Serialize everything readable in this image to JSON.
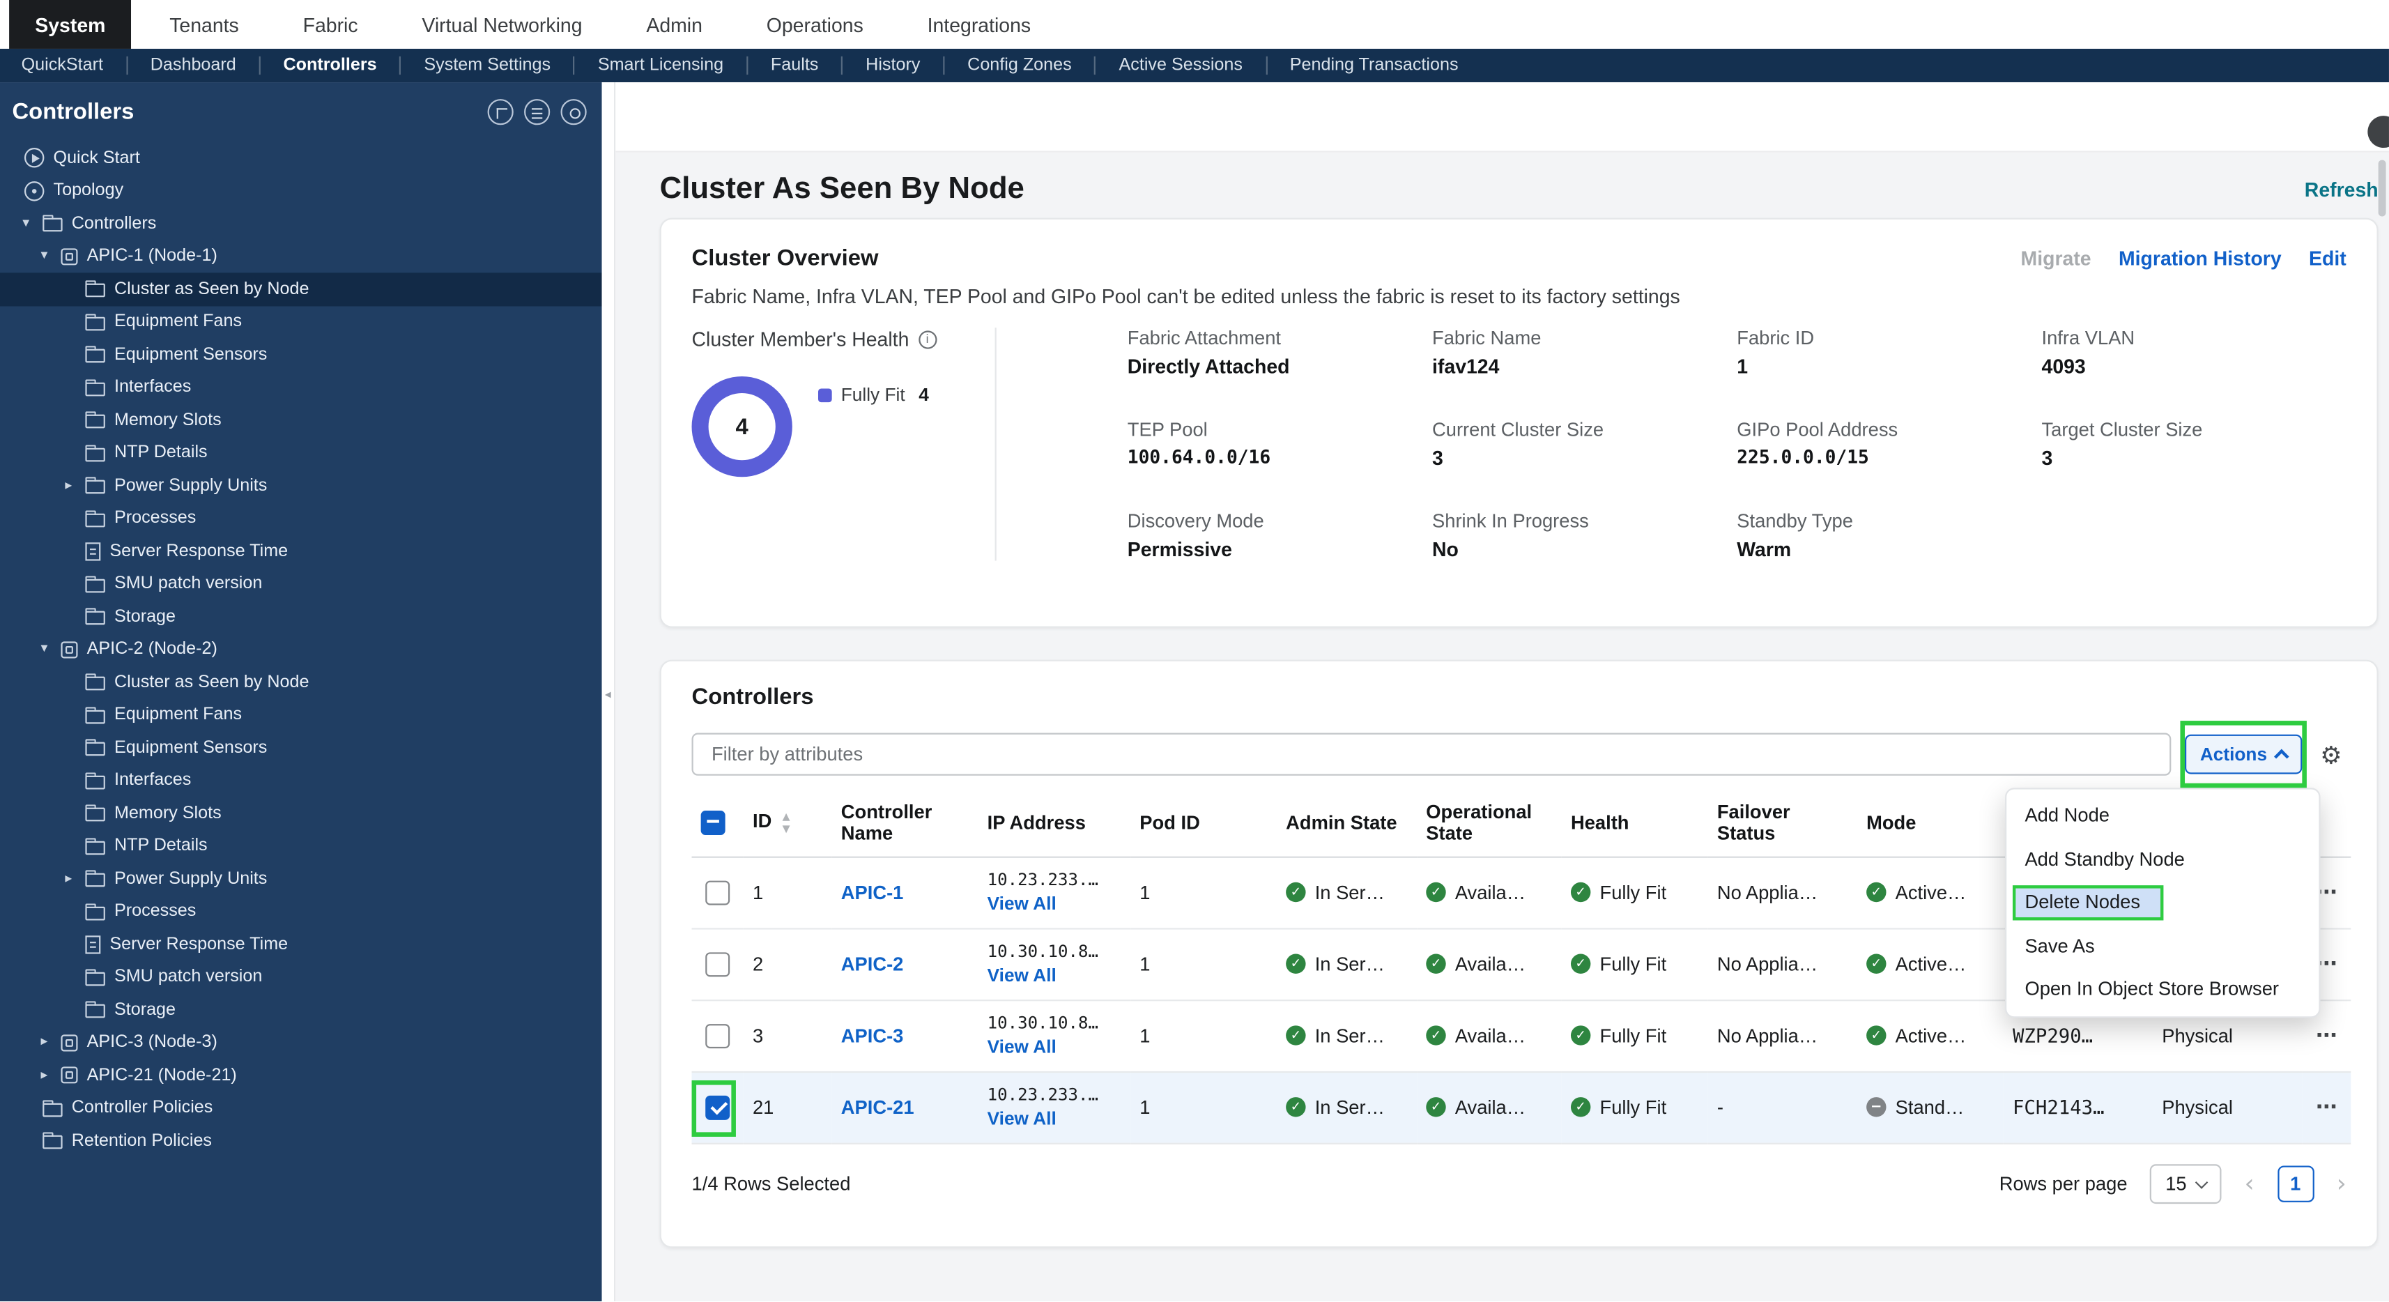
{
  "colors": {
    "accent_blue": "#1160c9",
    "status_green": "#2e8540",
    "donut_purple": "#5a5ed8",
    "annotation_green": "#2ecc40",
    "subnav_navy": "#143050",
    "sidebar_navy": "#203e63"
  },
  "top_nav": {
    "items": [
      "System",
      "Tenants",
      "Fabric",
      "Virtual Networking",
      "Admin",
      "Operations",
      "Integrations"
    ],
    "active": "System"
  },
  "sub_nav": {
    "items": [
      "QuickStart",
      "Dashboard",
      "Controllers",
      "System Settings",
      "Smart Licensing",
      "Faults",
      "History",
      "Config Zones",
      "Active Sessions",
      "Pending Transactions"
    ],
    "active": "Controllers"
  },
  "sidebar": {
    "title": "Controllers",
    "selected": "Cluster as Seen by Node",
    "tree": [
      "Quick Start",
      "Topology",
      "Controllers",
      "APIC-1 (Node-1)",
      "Cluster as Seen by Node",
      "Equipment Fans",
      "Equipment Sensors",
      "Interfaces",
      "Memory Slots",
      "NTP Details",
      "Power Supply Units",
      "Processes",
      "Server Response Time",
      "SMU patch version",
      "Storage",
      "APIC-2 (Node-2)",
      "Cluster as Seen by Node",
      "Equipment Fans",
      "Equipment Sensors",
      "Interfaces",
      "Memory Slots",
      "NTP Details",
      "Power Supply Units",
      "Processes",
      "Server Response Time",
      "SMU patch version",
      "Storage",
      "APIC-3 (Node-3)",
      "APIC-21 (Node-21)",
      "Controller Policies",
      "Retention Policies"
    ]
  },
  "main": {
    "page_title": "Cluster As Seen By Node",
    "refresh_label": "Refresh",
    "overview": {
      "title": "Cluster Overview",
      "note": "Fabric Name, Infra VLAN, TEP Pool and GIPo Pool can't be edited unless the fabric is reset to its factory settings",
      "links": {
        "migrate": "Migrate",
        "migration_history": "Migration History",
        "edit": "Edit"
      },
      "health": {
        "label": "Cluster Member's Health",
        "donut_value": "4",
        "legend_label": "Fully Fit",
        "legend_value": "4"
      },
      "fields": [
        {
          "label": "Fabric Attachment",
          "value": "Directly Attached"
        },
        {
          "label": "Fabric Name",
          "value": "ifav124"
        },
        {
          "label": "Fabric ID",
          "value": "1"
        },
        {
          "label": "Infra VLAN",
          "value": "4093"
        },
        {
          "label": "TEP Pool",
          "value": "100.64.0.0/16"
        },
        {
          "label": "Current Cluster Size",
          "value": "3"
        },
        {
          "label": "GIPo Pool Address",
          "value": "225.0.0.0/15"
        },
        {
          "label": "Target Cluster Size",
          "value": "3"
        },
        {
          "label": "Discovery Mode",
          "value": "Permissive"
        },
        {
          "label": "Shrink In Progress",
          "value": "No"
        },
        {
          "label": "Standby Type",
          "value": "Warm"
        }
      ]
    },
    "controllers": {
      "title": "Controllers",
      "filter_placeholder": "Filter by attributes",
      "actions_label": "Actions",
      "menu": [
        "Add Node",
        "Add Standby Node",
        "Delete Nodes",
        "Save As",
        "Open In Object Store Browser"
      ],
      "menu_highlighted": "Delete Nodes",
      "table": {
        "headers": [
          "ID",
          "Controller Name",
          "IP Address",
          "Pod ID",
          "Admin State",
          "Operational State",
          "Health",
          "Failover Status",
          "Mode"
        ],
        "rows": [
          {
            "id": "1",
            "name": "APIC-1",
            "ip": "10.23.233.…",
            "view_all": "View All",
            "pod_id": "1",
            "admin_state": "In Ser…",
            "operational_state": "Availa…",
            "health": "Fully Fit",
            "failover_status": "No Applia…",
            "mode": "Active…",
            "serial": "",
            "type": ""
          },
          {
            "id": "2",
            "name": "APIC-2",
            "ip": "10.30.10.8…",
            "view_all": "View All",
            "pod_id": "1",
            "admin_state": "In Ser…",
            "operational_state": "Availa…",
            "health": "Fully Fit",
            "failover_status": "No Applia…",
            "mode": "Active…",
            "serial": "",
            "type": ""
          },
          {
            "id": "3",
            "name": "APIC-3",
            "ip": "10.30.10.8…",
            "view_all": "View All",
            "pod_id": "1",
            "admin_state": "In Ser…",
            "operational_state": "Availa…",
            "health": "Fully Fit",
            "failover_status": "No Applia…",
            "mode": "Active…",
            "serial": "WZP290…",
            "type": "Physical"
          },
          {
            "id": "21",
            "name": "APIC-21",
            "ip": "10.23.233.…",
            "view_all": "View All",
            "pod_id": "1",
            "admin_state": "In Ser…",
            "operational_state": "Availa…",
            "health": "Fully Fit",
            "failover_status": "-",
            "mode": "Stand…",
            "serial": "FCH2143…",
            "type": "Physical"
          }
        ]
      },
      "footer": {
        "selected_text": "1/4 Rows Selected",
        "rows_per_page_label": "Rows per page",
        "rows_per_page_value": "15",
        "current_page": "1"
      }
    }
  }
}
